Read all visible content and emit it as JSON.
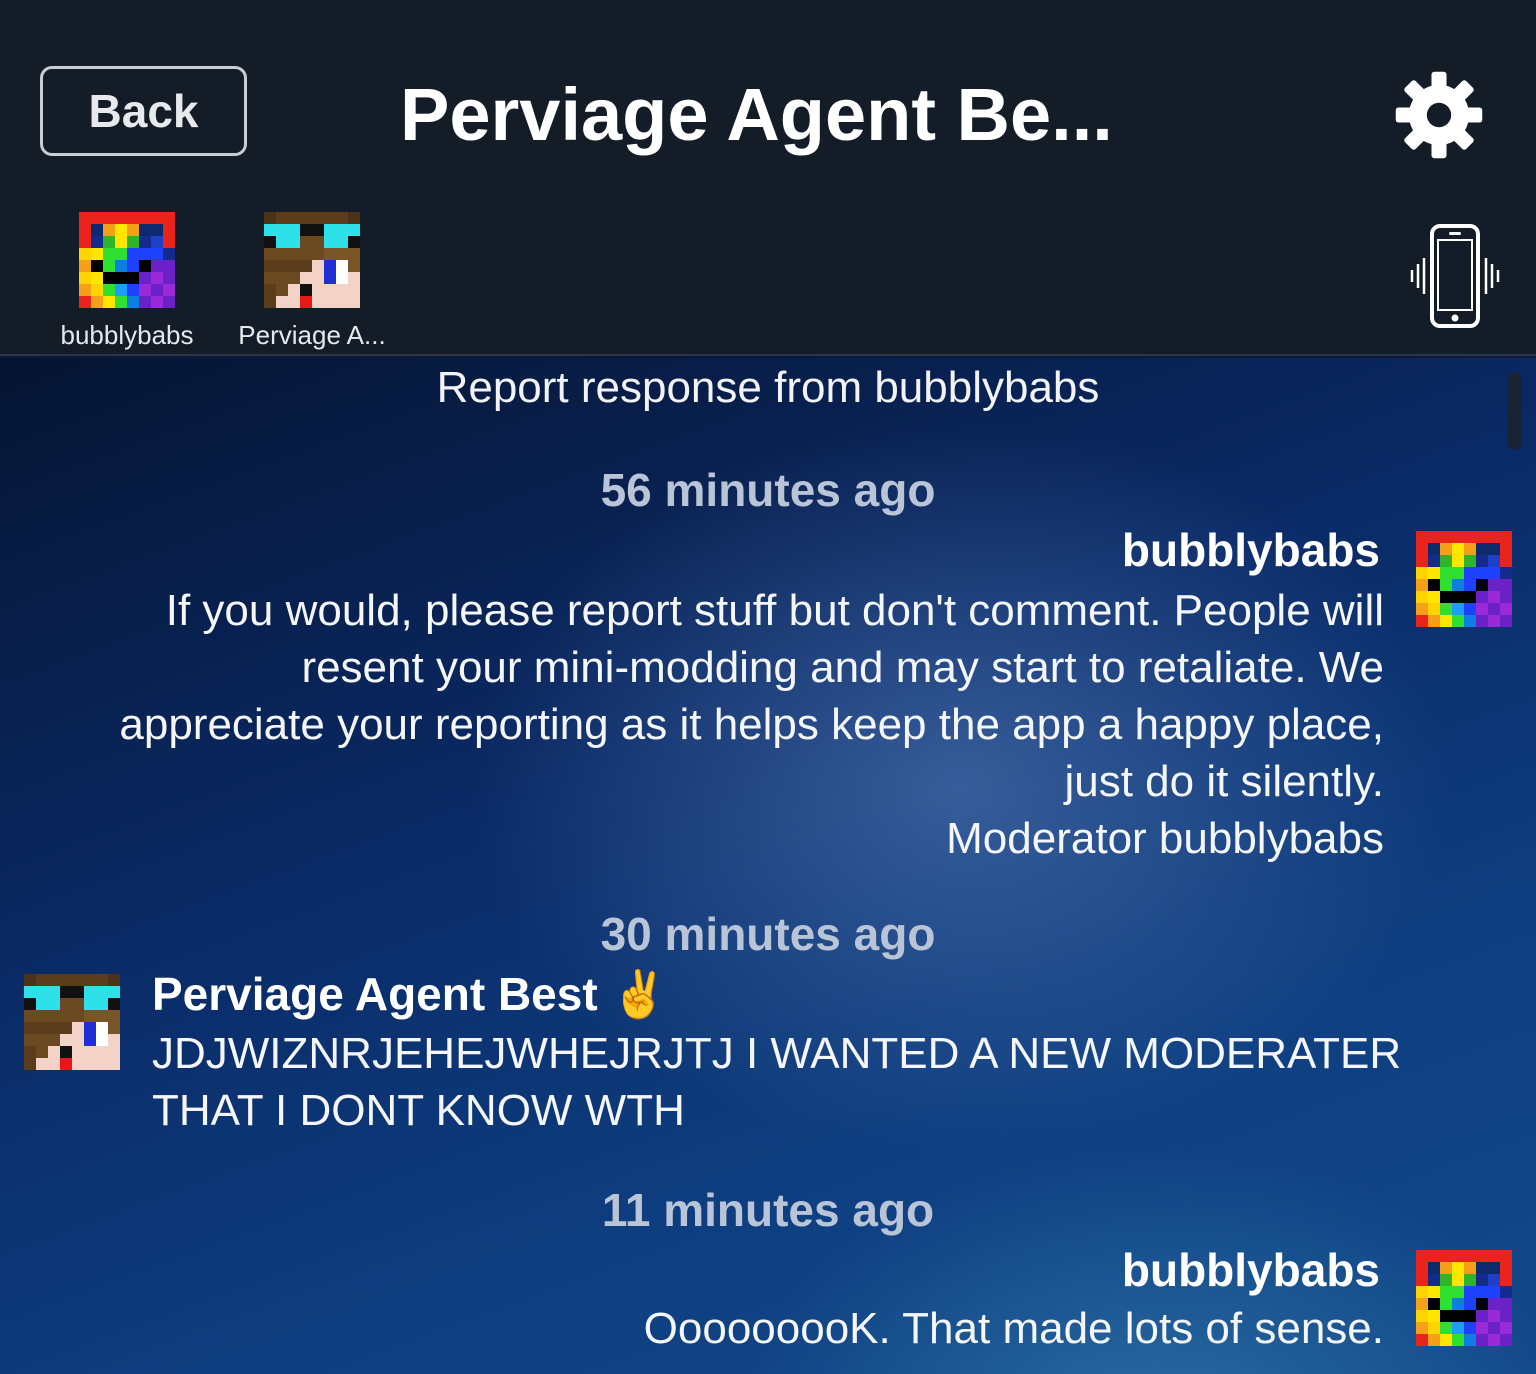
{
  "header": {
    "back_label": "Back",
    "title": "Perviage Agent Be...",
    "settings_icon": "gear-icon",
    "vibrate_icon": "phone-vibrate-icon"
  },
  "members": [
    {
      "name": "bubblybabs",
      "avatar": "rainbow-pixel-avatar"
    },
    {
      "name": "Perviage A...",
      "avatar": "sunglasses-pixel-avatar"
    }
  ],
  "chat": {
    "report_title": "Report response from bubblybabs",
    "messages": [
      {
        "time": "56 minutes ago",
        "sender": "bubblybabs",
        "lines": [
          "If you would, please report stuff but don't comment.  People will",
          "resent your mini-modding and may start to retaliate.  We",
          "appreciate your reporting as it helps keep the app a happy place,",
          "just do it silently.",
          "Moderator bubblybabs"
        ]
      },
      {
        "time": "30 minutes ago",
        "sender": "Perviage Agent Best ✌️",
        "lines": [
          "JDJWIZNRJEHEJWHEJRJTJ I WANTED A NEW MODERATER",
          "THAT I DONT KNOW WTH"
        ]
      },
      {
        "time": "11 minutes ago",
        "sender": "bubblybabs",
        "lines": [
          "OoooooooK.  That made lots of sense."
        ]
      }
    ]
  }
}
